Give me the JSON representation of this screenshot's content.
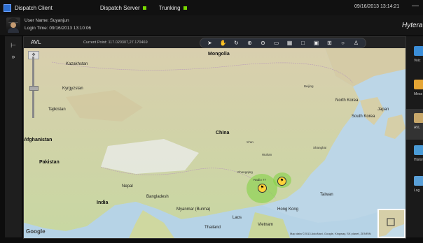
{
  "titlebar": {
    "title": "Dispatch Client",
    "server_label": "Dispatch Server",
    "trunking_label": "Trunking",
    "datetime": "09/16/2013 13:14:21",
    "minimize": "—"
  },
  "user": {
    "name_line": "User Name: Suyanjun",
    "login_line": "Login Time: 09/16/2013 13:10:06"
  },
  "brand": "Hytera",
  "panel": {
    "title": "AVL",
    "current_point": "Current Point: 117.020307,27.170469"
  },
  "toolbar": [
    {
      "name": "select-icon",
      "glyph": "➤"
    },
    {
      "name": "pan-hand-icon",
      "glyph": "✋"
    },
    {
      "name": "refresh-icon",
      "glyph": "↻"
    },
    {
      "name": "zoom-in-icon",
      "glyph": "⊕"
    },
    {
      "name": "zoom-out-icon",
      "glyph": "⊖"
    },
    {
      "name": "measure-icon",
      "glyph": "▭"
    },
    {
      "name": "layers-icon",
      "glyph": "▦"
    },
    {
      "name": "fullscreen-icon",
      "glyph": "□"
    },
    {
      "name": "screenshot-icon",
      "glyph": "▣"
    },
    {
      "name": "grid-icon",
      "glyph": "⊞"
    },
    {
      "name": "circle-icon",
      "glyph": "○"
    },
    {
      "name": "clear-icon",
      "glyph": "♙"
    }
  ],
  "map_labels": {
    "mongolia": "Mongolia",
    "china": "China",
    "kazakhstan": "Kazakhstan",
    "pakistan": "Pakistan",
    "india": "India",
    "afghanistan": "Afghanistan",
    "myanmar": "Myanmar (Burma)",
    "bangladesh": "Bangladesh",
    "north_korea": "North Korea",
    "south_korea": "South Korea",
    "japan": "Japan",
    "taiwan": "Taiwan",
    "hong_kong": "Hong Kong",
    "kyrgyzstan": "Kyrgyzstan",
    "tajikistan": "Tajikistan",
    "nepal": "Nepal",
    "thailand": "Thailand",
    "laos": "Laos",
    "vietnam": "Vietnam",
    "beijing": "Beijing",
    "shanghai": "Shanghai",
    "chongqing": "Chongqing",
    "wuhan": "Wuhan",
    "xian": "Xi'an",
    "radio_label": "Radio 77"
  },
  "map_footer": {
    "google": "Google",
    "copyright": "Map data ©2013 AutoNavi, Google, Kingway, SK planet, ZENRIN"
  },
  "right_panel": [
    {
      "label": "Voic",
      "color": "#3b8ed8"
    },
    {
      "label": "Mess",
      "color": "#e5a534"
    },
    {
      "label": "AVL",
      "color": "#c8a86a"
    },
    {
      "label": "Histori",
      "color": "#4a9bd6"
    },
    {
      "label": "Log",
      "color": "#5aa0d8"
    }
  ]
}
